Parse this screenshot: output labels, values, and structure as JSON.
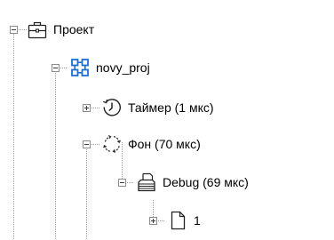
{
  "tree": {
    "root": {
      "label": "Проект",
      "icon": "briefcase-icon",
      "expanded": true,
      "children": [
        {
          "label": "novy_proj",
          "icon": "module-grid-icon",
          "icon_color": "#1f6fd1",
          "expanded": true,
          "children": [
            {
              "label": "Таймер (1 мкс)",
              "icon": "clock-icon",
              "expanded": false
            },
            {
              "label": "Фон (70 мкс)",
              "icon": "cycle-arrows-icon",
              "expanded": true,
              "children": [
                {
                  "label": "Debug (69 мкс)",
                  "icon": "stack-of-papers-icon",
                  "expanded": true,
                  "children": [
                    {
                      "label": "1",
                      "icon": "document-icon",
                      "expanded": false
                    }
                  ]
                }
              ]
            }
          ]
        }
      ]
    }
  },
  "colors": {
    "guide_line": "#9a9a9a",
    "expander_border": "#8c8c8c",
    "module_icon": "#1f6fd1",
    "text": "#000000"
  }
}
